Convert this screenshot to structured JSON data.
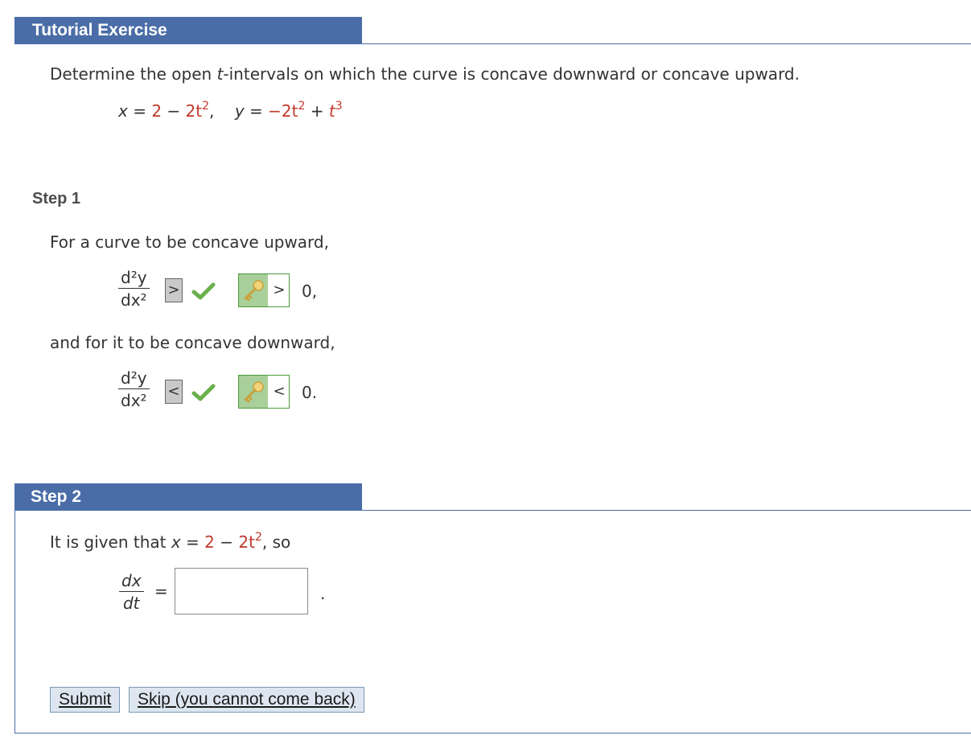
{
  "header": {
    "title": "Tutorial Exercise"
  },
  "problem": {
    "prompt_before": "Determine the open ",
    "prompt_var": "t",
    "prompt_after": "-intervals on which the curve is concave downward or concave upward.",
    "eq_x_lhs": "x",
    "eq_x_rhs_const": "2",
    "eq_x_rhs_rest": "2t",
    "eq_y_lhs": "y",
    "eq_y_rhs_a": "−2t",
    "eq_y_rhs_b": "t"
  },
  "step1": {
    "label": "Step 1",
    "text_upward": "For a curve to be concave upward,",
    "text_downward": "and for it to be concave downward,",
    "frac_num": "d²y",
    "frac_den": "dx²",
    "upward_answer": ">",
    "upward_key": ">",
    "upward_tail": "0,",
    "downward_answer": "<",
    "downward_key": "<",
    "downward_tail": "0."
  },
  "step2": {
    "label": "Step 2",
    "given_prefix": "It is given that ",
    "given_var": "x",
    "given_eq": " = ",
    "given_const": "2",
    "given_rest": "2t",
    "given_suffix": ", so",
    "frac_num": "dx",
    "frac_den": "dt",
    "equals": "=",
    "answer_value": "",
    "period": "."
  },
  "buttons": {
    "submit": "Submit",
    "skip": "Skip (you cannot come back)"
  },
  "colors": {
    "header_bg": "#4a6da7",
    "accent_red": "#c0392b",
    "check_green": "#6ab04c"
  }
}
